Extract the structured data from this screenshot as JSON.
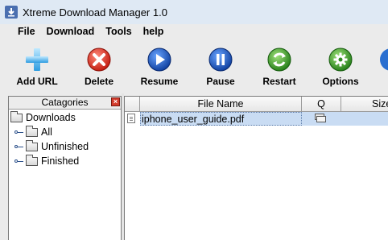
{
  "window": {
    "title": "Xtreme Download Manager 1.0"
  },
  "menu": [
    "File",
    "Download",
    "Tools",
    "help"
  ],
  "toolbar": [
    {
      "label": "Add URL",
      "icon": "plus-icon"
    },
    {
      "label": "Delete",
      "icon": "delete-icon"
    },
    {
      "label": "Resume",
      "icon": "play-icon"
    },
    {
      "label": "Pause",
      "icon": "pause-icon"
    },
    {
      "label": "Restart",
      "icon": "restart-icon"
    },
    {
      "label": "Options",
      "icon": "gear-icon"
    }
  ],
  "categories": {
    "header": "Catagories",
    "root": "Downloads",
    "items": [
      "All",
      "Unfinished",
      "Finished"
    ]
  },
  "table": {
    "columns": [
      "File Name",
      "Q",
      "Size"
    ],
    "rows": [
      {
        "file_name": "iphone_user_guide.pdf"
      }
    ]
  },
  "colors": {
    "selected_row": "#c9dcf3",
    "accent": "#2a4f8a"
  }
}
